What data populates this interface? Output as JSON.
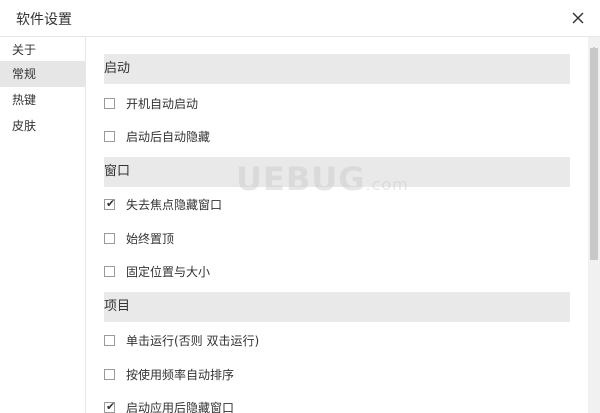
{
  "window": {
    "title": "软件设置"
  },
  "sidebar": {
    "items": [
      {
        "label": "关于",
        "active": false
      },
      {
        "label": "常规",
        "active": true
      },
      {
        "label": "热键",
        "active": false
      },
      {
        "label": "皮肤",
        "active": false
      }
    ]
  },
  "sections": [
    {
      "header": "启动",
      "options": [
        {
          "label": "开机自动启动",
          "checked": false
        },
        {
          "label": "启动后自动隐藏",
          "checked": false
        }
      ]
    },
    {
      "header": "窗口",
      "options": [
        {
          "label": "失去焦点隐藏窗口",
          "checked": true
        },
        {
          "label": "始终置顶",
          "checked": false
        },
        {
          "label": "固定位置与大小",
          "checked": false
        }
      ]
    },
    {
      "header": "项目",
      "options": [
        {
          "label": "单击运行(否则 双击运行)",
          "checked": false
        },
        {
          "label": "按使用频率自动排序",
          "checked": false
        },
        {
          "label": "启动应用后隐藏窗口",
          "checked": true
        }
      ]
    }
  ],
  "watermark": {
    "main": "UEBUG",
    "suffix": ".com"
  },
  "colors": {
    "header_bg": "#e9e9e9",
    "active_bg": "#e6e6e6"
  }
}
